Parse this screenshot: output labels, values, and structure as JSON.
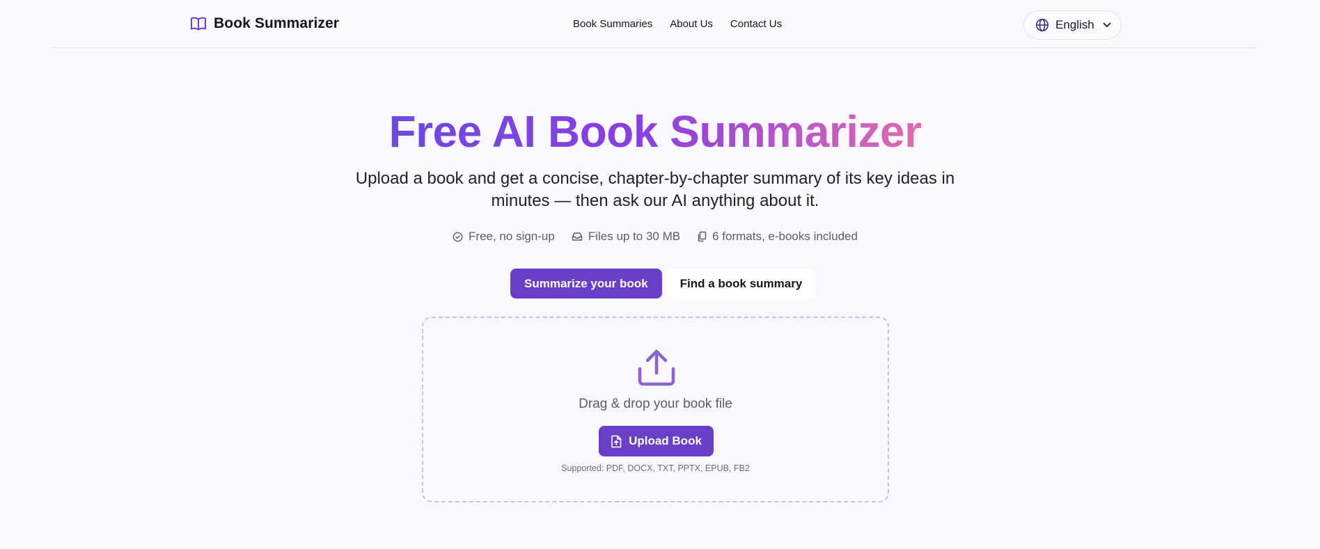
{
  "header": {
    "brand_name": "Book Summarizer",
    "brand_icon": "open-book-icon",
    "nav": [
      {
        "label": "Book Summaries"
      },
      {
        "label": "About Us"
      },
      {
        "label": "Contact Us"
      }
    ],
    "language": {
      "label": "English",
      "icon": "globe-icon"
    }
  },
  "hero": {
    "title": "Free AI Book Summarizer",
    "subtitle": "Upload a book and get a concise, chapter-by-chapter summary of its key ideas in minutes — then ask our AI anything about it.",
    "features": [
      {
        "label": "Free, no sign-up",
        "icon": "check-circle-icon"
      },
      {
        "label": "Files up to 30 MB",
        "icon": "inbox-icon"
      },
      {
        "label": "6 formats, e-books included",
        "icon": "copy-icon"
      }
    ],
    "primary_cta": "Summarize your book",
    "secondary_cta": "Find a book summary"
  },
  "upload": {
    "drop_text": "Drag & drop your book file",
    "button_label": "Upload Book",
    "supported": "Supported: PDF, DOCX, TXT, PPTX, EPUB, FB2"
  },
  "colors": {
    "accent": "#6a3fc8",
    "background": "#f9f8ff",
    "title_gradient_start": "#6d4ae0",
    "title_gradient_end": "#e06bae",
    "icon_purple": "#8a63d2"
  }
}
